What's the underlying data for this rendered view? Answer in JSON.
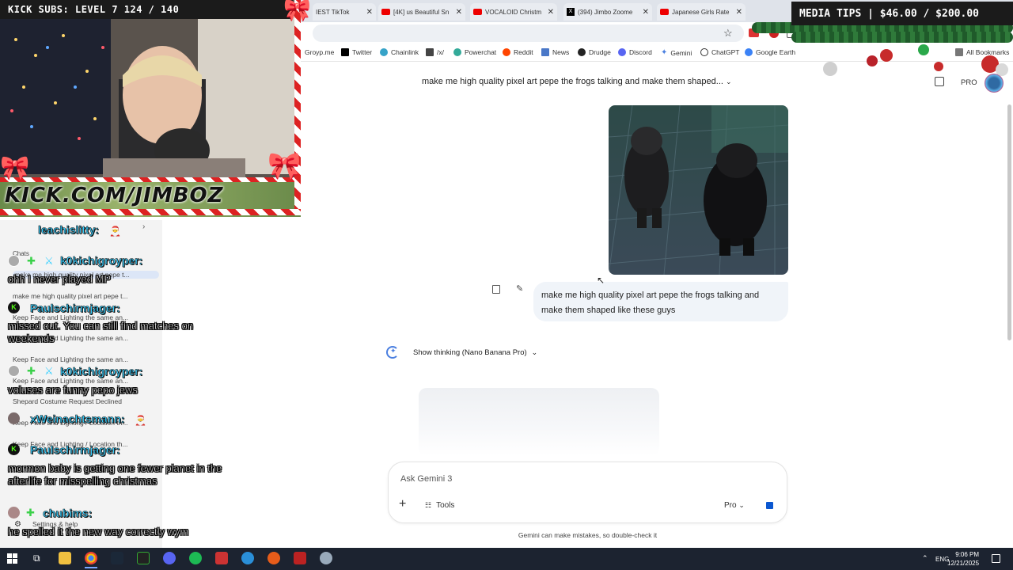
{
  "browser": {
    "tabs": [
      {
        "label": "IEST TikTok",
        "icon": "tiktok-icon"
      },
      {
        "label": "[4K] us Beautiful Sn",
        "icon": "youtube-icon"
      },
      {
        "label": "VOCALOID Christm",
        "icon": "youtube-icon"
      },
      {
        "label": "(394) Jimbo Zoome",
        "icon": "x-icon"
      },
      {
        "label": "Japanese Girls Rate",
        "icon": "youtube-icon"
      }
    ],
    "bookmarks": [
      "Groyp.me",
      "Twitter",
      "Chainlink",
      "/x/",
      "Powerchat",
      "Reddit",
      "News",
      "Drudge",
      "Discord",
      "Gemini",
      "ChatGPT",
      "Google Earth"
    ],
    "all_bookmarks": "All Bookmarks"
  },
  "gemini": {
    "conversation_title": "make me high quality pixel art pepe the frogs talking and make them shaped...",
    "pro_label": "PRO",
    "user_message": "make me high quality pixel art pepe the frogs talking and make them shaped like these guys",
    "thinking_label": "Show thinking (Nano Banana Pro)",
    "input_placeholder": "Ask Gemini 3",
    "tools_label": "Tools",
    "model_label": "Pro",
    "disclaimer": "Gemini can make mistakes, so double-check it",
    "sidebar": {
      "chats_label": "Chats",
      "items": [
        "make me high quality pixel art pepe t...",
        "make me high quality pixel art pepe t...",
        "Keep Face and Lighting the same an...",
        "Keep Face and Lighting the same an...",
        "Keep Face and Lighting the same an...",
        "Keep Face and Lighting the same an...",
        "Shepard Costume Request Declined",
        "Keep Face and Lighting / Location th...",
        "Keep Face and Lighting / Location th..."
      ],
      "settings_label": "Settings & help"
    }
  },
  "stream": {
    "kick_subs": "KICK SUBS: LEVEL 7 124 / 140",
    "media_tips": "MEDIA TIPS | $46.00 / $200.00",
    "channel_url": "KICK.COM/JIMBOZ",
    "chat": [
      {
        "user": "leachislitty:",
        "message": ""
      },
      {
        "user": "k0kichigroyper:",
        "message": "ohh I never played MP"
      },
      {
        "user": "Paulschirmjager:",
        "message": "missed out. You can still find matches on weekends"
      },
      {
        "user": "k0kichigroyper:",
        "message": "voluses are funny pepo jews"
      },
      {
        "user": "xWeinachtsmann:",
        "message": ""
      },
      {
        "user": "Paulschirmjager:",
        "message": "mormon baby is getting one fewer planet in the afterlife for misspelling christmas"
      },
      {
        "user": "chubims:",
        "message": "he spelled it the new way correctly wym"
      }
    ]
  },
  "taskbar": {
    "language": "ENG",
    "time": "9:06 PM",
    "date": "12/21/2025"
  },
  "colors": {
    "accent_blue": "#0b57d0",
    "bubble_bg": "#f0f4f9",
    "chat_name": "#3ad0ff"
  }
}
